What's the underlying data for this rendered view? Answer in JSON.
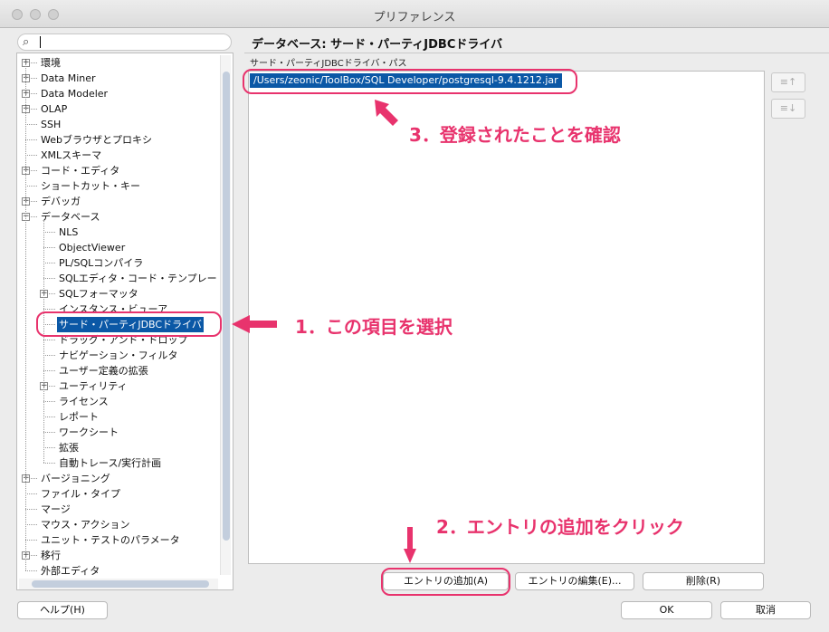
{
  "window": {
    "title": "プリファレンス"
  },
  "search": {
    "placeholder": ""
  },
  "tree": {
    "items": [
      {
        "label": "環境",
        "expander": "+"
      },
      {
        "label": "Data Miner",
        "expander": "+"
      },
      {
        "label": "Data Modeler",
        "expander": "+"
      },
      {
        "label": "OLAP",
        "expander": "+"
      },
      {
        "label": "SSH",
        "expander": ""
      },
      {
        "label": "Webブラウザとプロキシ",
        "expander": ""
      },
      {
        "label": "XMLスキーマ",
        "expander": ""
      },
      {
        "label": "コード・エディタ",
        "expander": "+"
      },
      {
        "label": "ショートカット・キー",
        "expander": ""
      },
      {
        "label": "デバッガ",
        "expander": "+"
      },
      {
        "label": "データベース",
        "expander": "−"
      },
      {
        "label": "NLS",
        "expander": ""
      },
      {
        "label": "ObjectViewer",
        "expander": ""
      },
      {
        "label": "PL/SQLコンパイラ",
        "expander": ""
      },
      {
        "label": "SQLエディタ・コード・テンプレー",
        "expander": ""
      },
      {
        "label": "SQLフォーマッタ",
        "expander": "+"
      },
      {
        "label": "インスタンス・ビューア",
        "expander": ""
      },
      {
        "label": "サード・パーティJDBCドライバ",
        "expander": ""
      },
      {
        "label": "ドラッグ・アンド・ドロップ",
        "expander": ""
      },
      {
        "label": "ナビゲーション・フィルタ",
        "expander": ""
      },
      {
        "label": "ユーザー定義の拡張",
        "expander": ""
      },
      {
        "label": "ユーティリティ",
        "expander": "+"
      },
      {
        "label": "ライセンス",
        "expander": ""
      },
      {
        "label": "レポート",
        "expander": ""
      },
      {
        "label": "ワークシート",
        "expander": ""
      },
      {
        "label": "拡張",
        "expander": ""
      },
      {
        "label": "自動トレース/実行計画",
        "expander": ""
      },
      {
        "label": "バージョニング",
        "expander": "+"
      },
      {
        "label": "ファイル・タイプ",
        "expander": ""
      },
      {
        "label": "マージ",
        "expander": ""
      },
      {
        "label": "マウス・アクション",
        "expander": ""
      },
      {
        "label": "ユニット・テストのパラメータ",
        "expander": ""
      },
      {
        "label": "移行",
        "expander": "+"
      },
      {
        "label": "外部エディタ",
        "expander": ""
      }
    ]
  },
  "panel": {
    "heading": "データベース: サード・パーティJDBCドライバ",
    "path_label": "サード・パーティJDBCドライバ・パス",
    "entries": [
      "/Users/zeonic/ToolBox/SQL Developer/postgresql-9.4.1212.jar"
    ],
    "move_up_label": "≡↑",
    "move_down_label": "≡↓",
    "add_button": "エントリの追加(A)",
    "edit_button": "エントリの編集(E)...",
    "delete_button": "削除(R)"
  },
  "footer": {
    "help_button": "ヘルプ(H)",
    "ok_button": "OK",
    "cancel_button": "取消"
  },
  "annotations": {
    "step1": "1．この項目を選択",
    "step2": "2．エントリの追加をクリック",
    "step3": "3．登録されたことを確認",
    "color": "#e8336d"
  },
  "colors": {
    "selection": "#0b58a6"
  }
}
